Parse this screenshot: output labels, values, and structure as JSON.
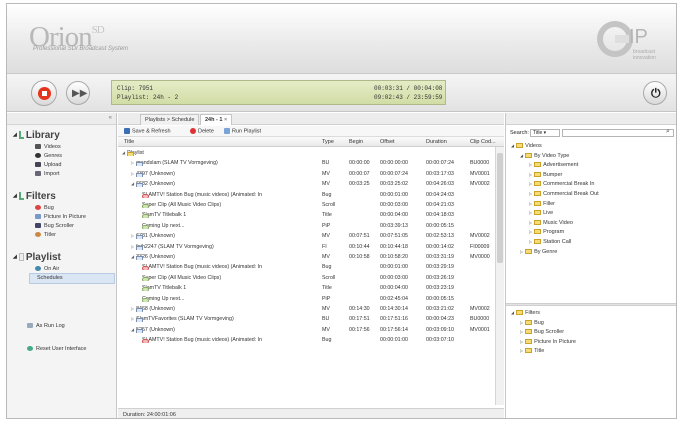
{
  "header": {
    "logo": "Orion",
    "logo_sup": "SD",
    "logo_sub": "Professional SDI Broadcast System"
  },
  "transport": {
    "clip_label": "Clip:",
    "clip_value": "7951",
    "playlist_label": "Playlist:",
    "playlist_value": "24h - 2",
    "time_row1": "00:03:31 / 00:04:08",
    "time_row2": "09:02:43 / 23:59:59"
  },
  "sidebar": {
    "collapse": "«",
    "library": {
      "title": "Library",
      "items": [
        "Videos",
        "Genres",
        "Upload",
        "Import"
      ]
    },
    "filters": {
      "title": "Filters",
      "items": [
        "Bug",
        "Picture In Picture",
        "Bug Scroller",
        "Titler"
      ]
    },
    "playlist": {
      "title": "Playlist",
      "items": [
        "On Air",
        "Schedules"
      ]
    },
    "as_run_log": "As Run Log",
    "reset": "Reset User Interface"
  },
  "center": {
    "tab_breadcrumb": "Playlists > Schedule",
    "tab_active": "24h - 1",
    "tab_close": "×",
    "toolbar": {
      "save": "Save & Refresh",
      "delete": "Delete",
      "run": "Run Playlist"
    },
    "columns": [
      "Title",
      "Type",
      "Begin",
      "Offset",
      "Duration",
      "Clip Cod..."
    ],
    "rows": [
      {
        "icon": "folder",
        "indent": 0,
        "title": "Playlist",
        "type": "",
        "begin": "",
        "offset": "",
        "duration": "",
        "code": ""
      },
      {
        "icon": "video",
        "indent": 1,
        "title": "grandslam (SLAM TV Vormgeving)",
        "type": "BU",
        "begin": "00:00:00",
        "offset": "00:00:00:00",
        "duration": "00:00:07:24",
        "code": "BU0000"
      },
      {
        "icon": "video",
        "indent": 1,
        "title": "4397 (Unknown)",
        "type": "MV",
        "begin": "00:00:07",
        "offset": "00:00:07:24",
        "duration": "00:03:17:03",
        "code": "MV0001"
      },
      {
        "icon": "video",
        "indent": 1,
        "title": "6682 (Unknown)",
        "type": "MV",
        "begin": "00:03:25",
        "offset": "00:03:25:02",
        "duration": "00:04:26:03",
        "code": "MV0002"
      },
      {
        "icon": "bug",
        "indent": 2,
        "title": "SLAMTV! Station Bug (music videos) (Animated: In",
        "type": "Bug",
        "begin": "",
        "offset": "00:00:01:00",
        "duration": "00:04:24:03",
        "code": ""
      },
      {
        "icon": "doc",
        "indent": 2,
        "title": "Super Clip (All Music Video Clips)",
        "type": "Scroll",
        "begin": "",
        "offset": "00:00:03:00",
        "duration": "00:04:21:03",
        "code": ""
      },
      {
        "icon": "doc",
        "indent": 2,
        "title": "SlamTV Titlebalk 1",
        "type": "Title",
        "begin": "",
        "offset": "00:00:04:00",
        "duration": "00:04:18:03",
        "code": ""
      },
      {
        "icon": "doc",
        "indent": 2,
        "title": "Coming Up next...",
        "type": "PiP",
        "begin": "",
        "offset": "00:03:39:13",
        "duration": "00:00:05:15",
        "code": ""
      },
      {
        "icon": "video",
        "indent": 1,
        "title": "6781 (Unknown)",
        "type": "MV",
        "begin": "00:07:51",
        "offset": "00:07:51:05",
        "duration": "00:02:53:13",
        "code": "MV0002"
      },
      {
        "icon": "video",
        "indent": 1,
        "title": "foth2247 (SLAM TV Vormgeving)",
        "type": "FI",
        "begin": "00:10:44",
        "offset": "00:10:44:18",
        "duration": "00:00:14:02",
        "code": "FI00009"
      },
      {
        "icon": "video",
        "indent": 1,
        "title": "3326 (Unknown)",
        "type": "MV",
        "begin": "00:10:58",
        "offset": "00:10:58:20",
        "duration": "00:03:31:19",
        "code": "MV0000"
      },
      {
        "icon": "bug",
        "indent": 2,
        "title": "SLAMTV! Station Bug (music videos) (Animated: In",
        "type": "Bug",
        "begin": "",
        "offset": "00:00:01:00",
        "duration": "00:03:29:19",
        "code": ""
      },
      {
        "icon": "doc",
        "indent": 2,
        "title": "Super Clip (All Music Video Clips)",
        "type": "Scroll",
        "begin": "",
        "offset": "00:00:03:00",
        "duration": "00:03:26:19",
        "code": ""
      },
      {
        "icon": "doc",
        "indent": 2,
        "title": "SlamTV Titlebalk 1",
        "type": "Title",
        "begin": "",
        "offset": "00:00:04:00",
        "duration": "00:03:23:19",
        "code": ""
      },
      {
        "icon": "doc",
        "indent": 2,
        "title": "Coming Up next...",
        "type": "PiP",
        "begin": "",
        "offset": "00:02:45:04",
        "duration": "00:00:05:15",
        "code": ""
      },
      {
        "icon": "video",
        "indent": 1,
        "title": "8468 (Unknown)",
        "type": "MV",
        "begin": "00:14:30",
        "offset": "00:14:30:14",
        "duration": "00:03:21:02",
        "code": "MV0002"
      },
      {
        "icon": "video",
        "indent": 1,
        "title": "SlamTVFavorites (SLAM TV Vormgeving)",
        "type": "BU",
        "begin": "00:17:51",
        "offset": "00:17:51:16",
        "duration": "00:00:04:23",
        "code": "BU0000"
      },
      {
        "icon": "video",
        "indent": 1,
        "title": "5257 (Unknown)",
        "type": "MV",
        "begin": "00:17:56",
        "offset": "00:17:56:14",
        "duration": "00:03:09:10",
        "code": "MV0001"
      },
      {
        "icon": "bug",
        "indent": 2,
        "title": "SLAMTV! Station Bug (music videos) (Animated: In",
        "type": "Bug",
        "begin": "",
        "offset": "00:00:01:00",
        "duration": "00:03:07:10",
        "code": ""
      }
    ],
    "status": "Duration: 24:00:01:06"
  },
  "rightpanel": {
    "search_label": "Search:",
    "search_field": "Title",
    "videos_tree": [
      {
        "level": 0,
        "label": "Videos",
        "open": true
      },
      {
        "level": 1,
        "label": "By Video Type",
        "open": true
      },
      {
        "level": 2,
        "label": "Advertisement"
      },
      {
        "level": 2,
        "label": "Bumper"
      },
      {
        "level": 2,
        "label": "Commercial Break In"
      },
      {
        "level": 2,
        "label": "Commercial Break Out"
      },
      {
        "level": 2,
        "label": "Filler"
      },
      {
        "level": 2,
        "label": "Live"
      },
      {
        "level": 2,
        "label": "Music Video"
      },
      {
        "level": 2,
        "label": "Program"
      },
      {
        "level": 2,
        "label": "Station Call"
      },
      {
        "level": 1,
        "label": "By Genre"
      }
    ],
    "filters_tree": [
      {
        "level": 0,
        "label": "Filters",
        "open": true
      },
      {
        "level": 1,
        "label": "Bug"
      },
      {
        "level": 1,
        "label": "Bug Scroller"
      },
      {
        "level": 1,
        "label": "Picture In Picture"
      },
      {
        "level": 1,
        "label": "Title"
      }
    ]
  },
  "colors": {
    "accent_red": "#e8331c",
    "clip_bg": "#dbe4b8",
    "selection": "#dbe6f4"
  }
}
